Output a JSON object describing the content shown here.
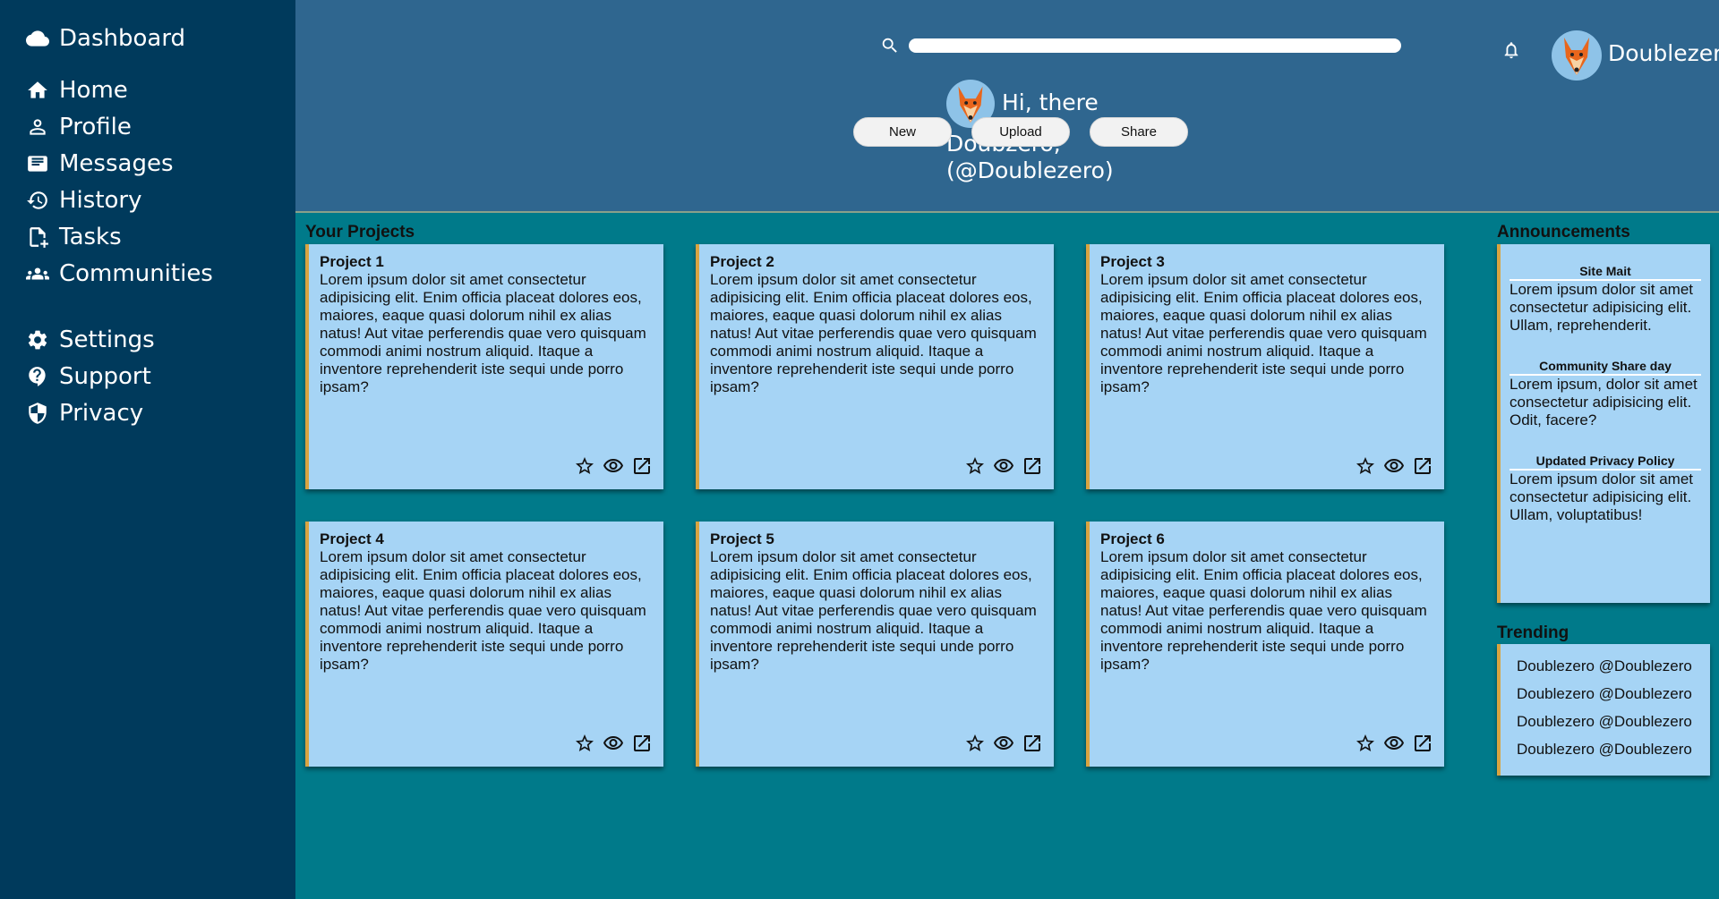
{
  "sidebar": {
    "items": [
      {
        "label": "Dashboard",
        "icon": "cloud-icon"
      },
      {
        "label": "Home",
        "icon": "home-icon"
      },
      {
        "label": "Profile",
        "icon": "person-icon"
      },
      {
        "label": "Messages",
        "icon": "messages-icon"
      },
      {
        "label": "History",
        "icon": "history-icon"
      },
      {
        "label": "Tasks",
        "icon": "tasks-icon"
      },
      {
        "label": "Communities",
        "icon": "group-icon"
      },
      {
        "label": "Settings",
        "icon": "gear-icon"
      },
      {
        "label": "Support",
        "icon": "support-icon"
      },
      {
        "label": "Privacy",
        "icon": "shield-icon"
      }
    ]
  },
  "header": {
    "username": "Doublezero",
    "greeting_line1": "Hi, there",
    "greeting_line2": "Doubzero, (@Doublezero)",
    "buttons": {
      "new": "New",
      "upload": "Upload",
      "share": "Share"
    }
  },
  "projects": {
    "title": "Your Projects",
    "items": [
      {
        "title": "Project 1",
        "body": "Lorem ipsum dolor sit amet consectetur adipisicing elit. Enim officia placeat dolores eos, maiores, eaque quasi dolorum nihil ex alias natus! Aut vitae perferendis quae vero quisquam commodi animi nostrum aliquid. Itaque a inventore reprehenderit iste sequi unde porro ipsam?"
      },
      {
        "title": "Project 2",
        "body": "Lorem ipsum dolor sit amet consectetur adipisicing elit. Enim officia placeat dolores eos, maiores, eaque quasi dolorum nihil ex alias natus! Aut vitae perferendis quae vero quisquam commodi animi nostrum aliquid. Itaque a inventore reprehenderit iste sequi unde porro ipsam?"
      },
      {
        "title": "Project 3",
        "body": "Lorem ipsum dolor sit amet consectetur adipisicing elit. Enim officia placeat dolores eos, maiores, eaque quasi dolorum nihil ex alias natus! Aut vitae perferendis quae vero quisquam commodi animi nostrum aliquid. Itaque a inventore reprehenderit iste sequi unde porro ipsam?"
      },
      {
        "title": "Project 4",
        "body": "Lorem ipsum dolor sit amet consectetur adipisicing elit. Enim officia placeat dolores eos, maiores, eaque quasi dolorum nihil ex alias natus! Aut vitae perferendis quae vero quisquam commodi animi nostrum aliquid. Itaque a inventore reprehenderit iste sequi unde porro ipsam?"
      },
      {
        "title": "Project 5",
        "body": "Lorem ipsum dolor sit amet consectetur adipisicing elit. Enim officia placeat dolores eos, maiores, eaque quasi dolorum nihil ex alias natus! Aut vitae perferendis quae vero quisquam commodi animi nostrum aliquid. Itaque a inventore reprehenderit iste sequi unde porro ipsam?"
      },
      {
        "title": "Project 6",
        "body": "Lorem ipsum dolor sit amet consectetur adipisicing elit. Enim officia placeat dolores eos, maiores, eaque quasi dolorum nihil ex alias natus! Aut vitae perferendis quae vero quisquam commodi animi nostrum aliquid. Itaque a inventore reprehenderit iste sequi unde porro ipsam?"
      }
    ]
  },
  "announcements": {
    "title": "Announcements",
    "items": [
      {
        "heading": "Site Mait",
        "text": "Lorem ipsum dolor sit amet consectetur adipisicing elit. Ullam, reprehenderit."
      },
      {
        "heading": "Community Share day",
        "text": "Lorem ipsum, dolor sit amet consectetur adipisicing elit. Odit, facere?"
      },
      {
        "heading": "Updated Privacy Policy",
        "text": "Lorem ipsum dolor sit amet consectetur adipisicing elit. Ullam, voluptatibus!"
      }
    ]
  },
  "trending": {
    "title": "Trending",
    "items": [
      "Doublezero @Doublezero",
      "Doublezero @Doublezero",
      "Doublezero @Doublezero",
      "Doublezero @Doublezero"
    ]
  },
  "colors": {
    "sidebar": "#003a5c",
    "header": "#2f668f",
    "background": "#007a8a",
    "card": "#a6d4f5",
    "card_accent": "#d9a441"
  }
}
